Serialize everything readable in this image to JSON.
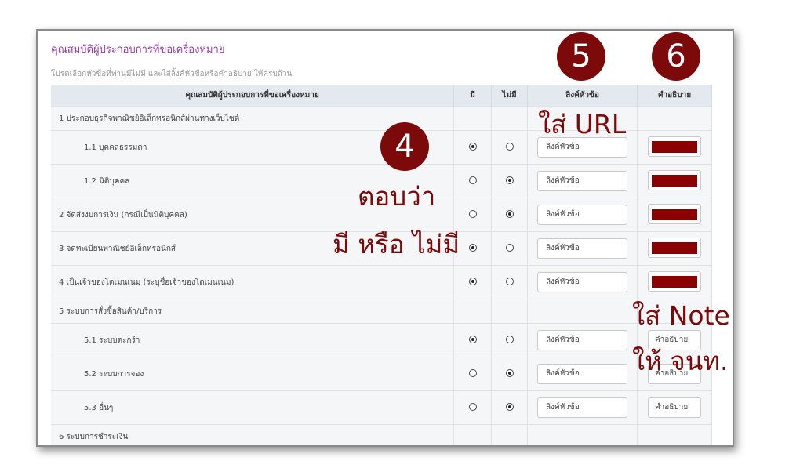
{
  "form": {
    "title": "คุณสมบัติผู้ประกอบการที่ขอเครื่องหมาย",
    "subtitle": "โปรดเลือกหัวข้อที่ท่านมีไม่มี และใส่ลิ้งค์หัวข้อหรือคำอธิบาย ให้ครบถ้วน",
    "columns": {
      "topic": "คุณสมบัติผู้ประกอบการที่ขอเครื่องหมาย",
      "yes": "มี",
      "no": "ไม่มี",
      "link": "ลิงค์หัวข้อ",
      "description": "คำอธิบาย"
    },
    "link_placeholder": "ลิงค์หัวข้อ",
    "description_placeholder": "คำอธิบาย",
    "rows": [
      {
        "label": "1 ประกอบธุรกิจพาณิชย์อิเล็กทรอนิกส์ผ่านทางเว็บไซต์",
        "section": true
      },
      {
        "label": "1.1 บุคคลธรรมดา",
        "answer": "yes",
        "description": "redacted"
      },
      {
        "label": "1.2 นิติบุคคล",
        "answer": "no",
        "description": "redacted"
      },
      {
        "label": "2 จัดส่งงบการเงิน (กรณีเป็นนิติบุคคล)",
        "answer": "no",
        "description": "redacted"
      },
      {
        "label": "3 จดทะเบียนพาณิชย์อิเล็กทรอนิกส์",
        "answer": "yes",
        "description": "redacted"
      },
      {
        "label": "4 เป็นเจ้าของโดเมนเนม (ระบุชื่อเจ้าของโดเมนเนม)",
        "answer": "yes",
        "description": "redacted"
      },
      {
        "label": "5 ระบบการสั่งซื้อสินค้า/บริการ",
        "section": true
      },
      {
        "label": "5.1 ระบบตะกร้า",
        "answer": "yes",
        "description": "คำอธิบาย"
      },
      {
        "label": "5.2 ระบบการจอง",
        "answer": "no",
        "description": "คำอธิบาย"
      },
      {
        "label": "5.3 อื่นๆ",
        "answer": "no",
        "description": "คำอธิบาย"
      },
      {
        "label": "6 ระบบการชำระเงิน",
        "section": true
      }
    ]
  },
  "annotations": {
    "marker4": "4",
    "marker5": "5",
    "marker6": "6",
    "text_answer_1": "ตอบว่า",
    "text_answer_2": "มี หรือ ไม่มี",
    "text_url": "ใส่ URL",
    "text_note_1": "ใส่ Note",
    "text_note_2": "ให้ จนท."
  },
  "colors": {
    "title": "#9b3da8",
    "marker": "#7c0a0a",
    "redaction": "#8b0000"
  }
}
